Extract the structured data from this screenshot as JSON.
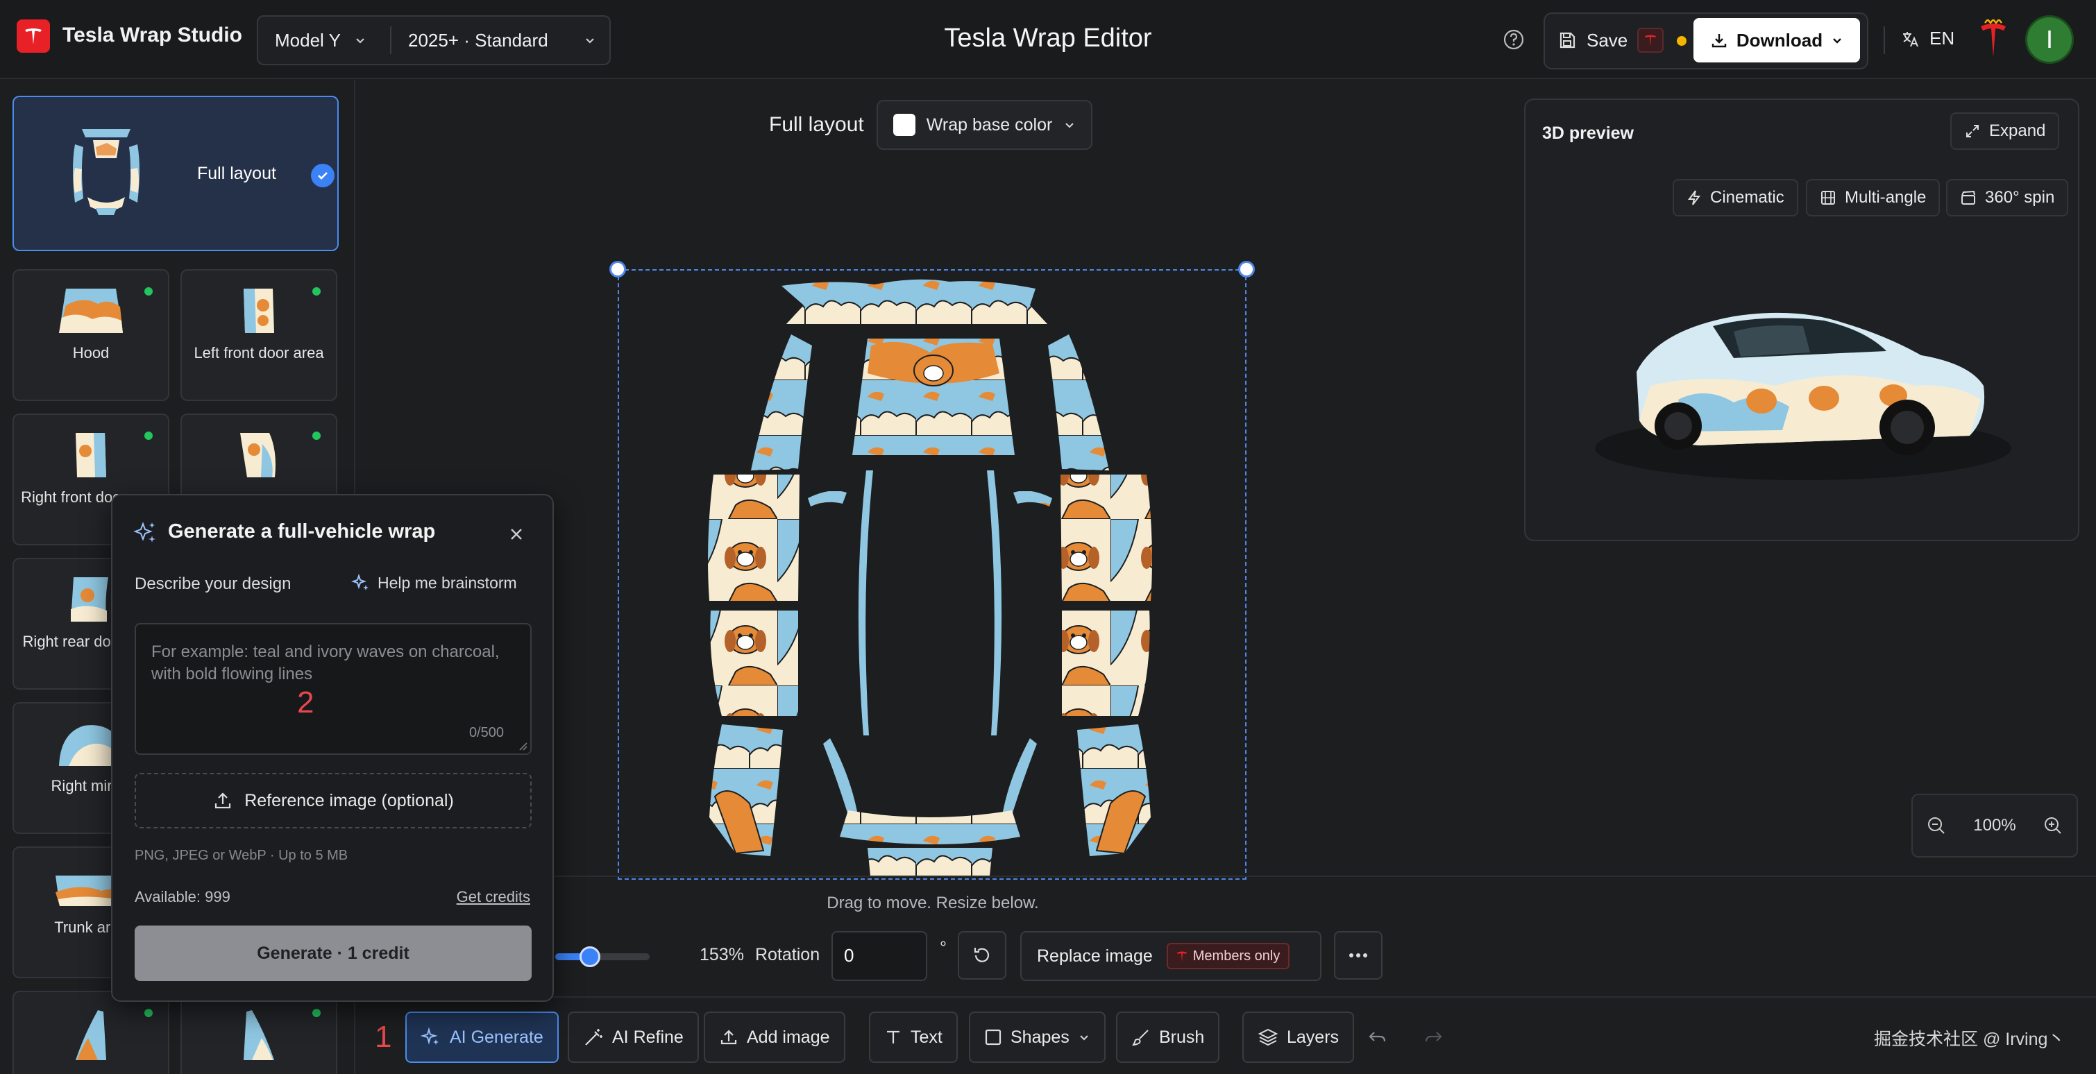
{
  "brand": {
    "name": "Tesla Wrap Studio"
  },
  "header": {
    "model": "Model Y",
    "trim": "2025+ · Standard",
    "title": "Tesla Wrap Editor",
    "save_label": "Save",
    "download_label": "Download",
    "language": "EN",
    "avatar_initial": "I"
  },
  "sidebar": {
    "full_layout_label": "Full layout",
    "parts": [
      {
        "label": "Hood"
      },
      {
        "label": "Left front door area"
      },
      {
        "label": "Right front door area"
      },
      {
        "label": ""
      },
      {
        "label": "Right rear door area"
      },
      {
        "label": ""
      },
      {
        "label": "Right mirror"
      },
      {
        "label": ""
      },
      {
        "label": "Trunk area"
      },
      {
        "label": ""
      },
      {
        "label": ""
      },
      {
        "label": ""
      }
    ]
  },
  "canvas": {
    "heading": "Full layout",
    "base_color_label": "Wrap base color",
    "base_color": "#ffffff",
    "drag_hint": "Drag to move. Resize below."
  },
  "preview": {
    "title": "3D preview",
    "expand_label": "Expand",
    "modes": [
      "Cinematic",
      "Multi-angle",
      "360° spin"
    ],
    "zoom": "100%"
  },
  "controls": {
    "scale_value": 0.37,
    "scale_percent": "153%",
    "rotation_label": "Rotation",
    "rotation_value": "0",
    "degree_symbol": "°",
    "replace_image_label": "Replace image",
    "members_only_label": "Members only"
  },
  "toolbar": {
    "ai_generate": "AI Generate",
    "ai_refine": "AI Refine",
    "add_image": "Add image",
    "text": "Text",
    "shapes": "Shapes",
    "brush": "Brush",
    "layers": "Layers"
  },
  "popup": {
    "title": "Generate a full-vehicle wrap",
    "describe_label": "Describe your design",
    "brainstorm_label": "Help me brainstorm",
    "placeholder": "For example: teal and ivory waves on charcoal, with bold flowing lines",
    "char_count": "0/500",
    "reference_label": "Reference image (optional)",
    "file_hint": "PNG, JPEG or WebP · Up to 5 MB",
    "available": "Available: 999",
    "get_credits": "Get credits",
    "generate_label": "Generate · 1 credit"
  },
  "annotations": {
    "marker_1": "1",
    "marker_2": "2"
  },
  "watermark": "掘金技术社区 @ Irving丶",
  "colors": {
    "accent": "#3b82f6",
    "tesla_red": "#e82127",
    "wrap_blue": "#8fc7e2",
    "wrap_orange": "#e58a37",
    "wrap_cream": "#f7ecd2",
    "status_green": "#22c55e"
  }
}
